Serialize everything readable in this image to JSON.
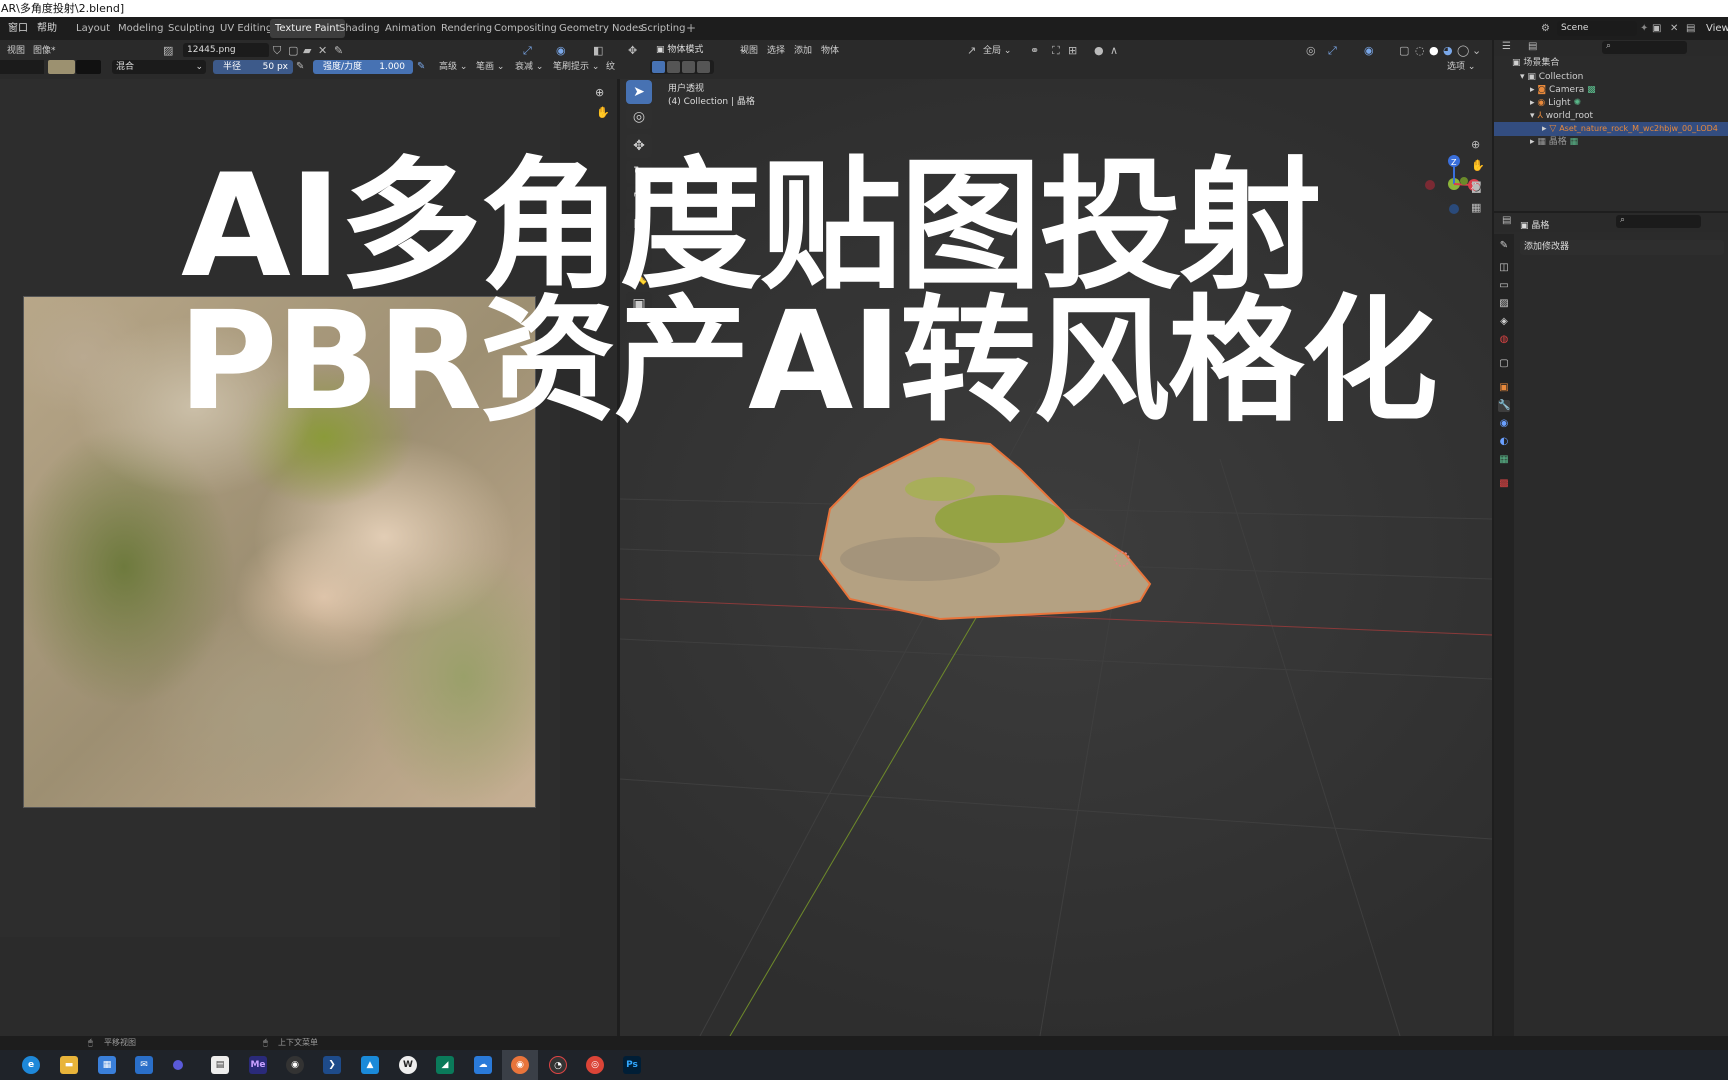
{
  "window": {
    "title": "AR\\多角度投射\\2.blend]"
  },
  "menubar": {
    "menus": [
      "窗口",
      "帮助"
    ],
    "tabs": [
      "Layout",
      "Modeling",
      "Sculpting",
      "UV Editing",
      "Texture Paint",
      "Shading",
      "Animation",
      "Rendering",
      "Compositing",
      "Geometry Nodes",
      "Scripting"
    ],
    "active_tab": "Texture Paint",
    "scene_label": "Scene",
    "view_layer_label": "View"
  },
  "image_editor": {
    "menus": [
      "视图",
      "图像*"
    ],
    "image_name": "12445.png",
    "blend_label": "混合",
    "radius_label": "半径",
    "radius_value": "50 px",
    "strength_label": "强度/力度",
    "strength_value": "1.000",
    "advanced_label": "高级",
    "stroke_label": "笔画",
    "falloff_label": "衰减",
    "cursor_label": "笔刷提示",
    "texture_label": "纹",
    "primary_color": "#9c9170",
    "secondary_color": "#111111"
  },
  "viewport": {
    "mode_label": "物体模式",
    "menus": [
      "视图",
      "选择",
      "添加",
      "物体"
    ],
    "global_label": "全局",
    "options_label": "选项",
    "view_name": "用户透视",
    "collection_info": "(4) Collection | 晶格",
    "gizmo_axes": [
      "Z",
      "X"
    ]
  },
  "outliner": {
    "root": "场景集合",
    "items": [
      {
        "label": "Collection",
        "icon": "collection-icon"
      },
      {
        "label": "Camera",
        "icon": "camera-icon"
      },
      {
        "label": "Light",
        "icon": "light-icon"
      },
      {
        "label": "world_root",
        "icon": "empty-icon"
      },
      {
        "label": "Aset_nature_rock_M_wc2hbjw_00_LOD4",
        "icon": "mesh-icon",
        "selected": true
      },
      {
        "label": "晶格",
        "icon": "lattice-icon"
      }
    ]
  },
  "properties": {
    "object_name": "晶格",
    "add_modifier": "添加修改器"
  },
  "statusbar": {
    "items": [
      "平移视图",
      "上下文菜单"
    ]
  },
  "taskbar": {
    "apps": [
      "edge",
      "explorer",
      "store",
      "mail",
      "app5",
      "notepad",
      "Me",
      "obs",
      "powershell",
      "app10",
      "W",
      "app12",
      "onedrive",
      "blender",
      "app15",
      "chrome",
      "Ps"
    ],
    "active_app": "blender"
  },
  "overlay": {
    "line1": "AI多角度贴图投射",
    "line2": "PBR资产AI转风格化"
  },
  "colors": {
    "accent_blue": "#4772b3",
    "selection_orange": "#e8743b",
    "header_bg": "#2a2a2a"
  }
}
